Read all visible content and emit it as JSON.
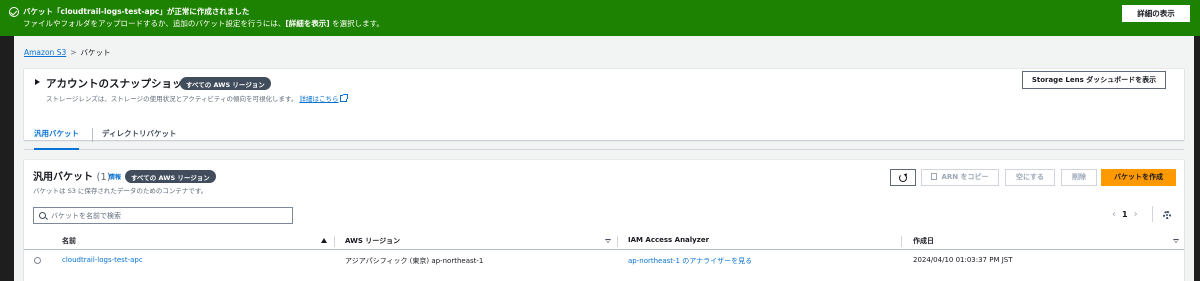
{
  "flash": {
    "title": "バケット「cloudtrail-logs-test-apc」が正常に作成されました",
    "message_prefix": "ファイルやフォルダをアップロードするか、追加のバケット設定を行うには、",
    "message_bold": "[詳細を表示]",
    "message_suffix": " を選択します。",
    "details_button": "詳細の表示",
    "color": "#1d8102"
  },
  "breadcrumb": {
    "root": "Amazon S3",
    "separator": ">",
    "current": "バケット"
  },
  "snapshot": {
    "title": "アカウントのスナップショット",
    "badge": "すべての AWS リージョン",
    "description": "ストレージレンズは、ストレージの使用状況とアクティビティの傾向を可視化します。",
    "link": "詳細はこちら",
    "lens_button": "Storage Lens ダッシュボードを表示"
  },
  "tabs": [
    {
      "label": "汎用バケット",
      "active": true
    },
    {
      "label": "ディレクトリバケット",
      "active": false
    }
  ],
  "buckets": {
    "title": "汎用バケット",
    "count": "(1)",
    "info": "情報",
    "badge": "すべての AWS リージョン",
    "description": "バケットは S3 に保存されたデータのためのコンテナです。",
    "actions": {
      "copy_arn": "ARN をコピー",
      "empty": "空にする",
      "delete": "削除",
      "create": "バケットを作成"
    },
    "search_placeholder": "バケットを名前で検索",
    "pagination": {
      "prev": "‹",
      "page": "1",
      "next": "›"
    },
    "columns": [
      "名前",
      "AWS リージョン",
      "IAM Access Analyzer",
      "作成日"
    ],
    "rows": [
      {
        "name": "cloudtrail-logs-test-apc",
        "region": "アジアパシフィック (東京) ap-northeast-1",
        "analyzer": "ap-northeast-1 のアナライザーを見る",
        "created": "2024/04/10 01:03:37 PM JST"
      }
    ]
  },
  "colors": {
    "accent": "#0972d3",
    "primary_button": "#ff9900",
    "badge": "#414d5c"
  }
}
